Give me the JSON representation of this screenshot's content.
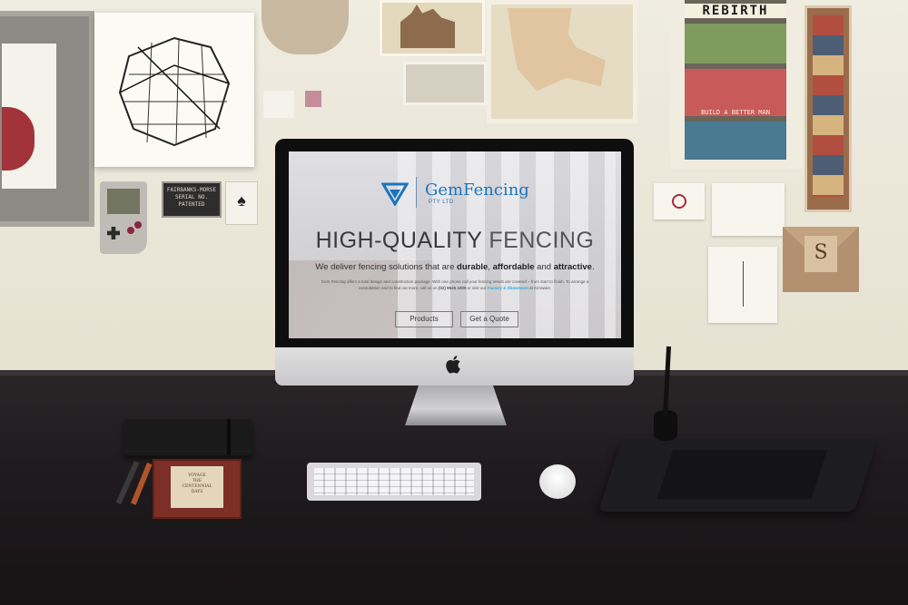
{
  "scene": {
    "wall_color": "#ece8da",
    "desk_color": "#211d20"
  },
  "wall": {
    "poster_title": "REBIRTH",
    "poster_caption": "BUILD A BETTER MAN",
    "plate_text": "FAIRBANKS-MORSE\nSERIAL NO.\nPATENTED",
    "card_suit": "♠",
    "kraft_letter": "S"
  },
  "website": {
    "brand": {
      "name": "GemFencing",
      "subtitle": "PTY LTD",
      "color": "#1c74bc"
    },
    "headline": {
      "bold": "HIGH-QUALITY",
      "light": "FENCING"
    },
    "tagline": {
      "prefix": "We deliver fencing solutions that are ",
      "word1": "durable",
      "sep1": ", ",
      "word2": "affordable",
      "sep2": " and ",
      "word3": "attractive",
      "suffix": "."
    },
    "body": {
      "text1": "Gem Fencing offers a total design and construction package. With one phone call your fencing needs are covered – from start to finish. To arrange a consultation and to find out more, call us on ",
      "phone": "(02) 9545 4300",
      "text2": " or visit our ",
      "showroom": "Factory & Showroom",
      "text3": " at Kirrawee."
    },
    "buttons": {
      "products": "Products",
      "quote": "Get a Quote"
    }
  },
  "computer": {
    "apple_logo": ""
  },
  "desk": {
    "book_text": "VOYAGE\nTHE\nCENTENNIAL\nDAYS"
  }
}
